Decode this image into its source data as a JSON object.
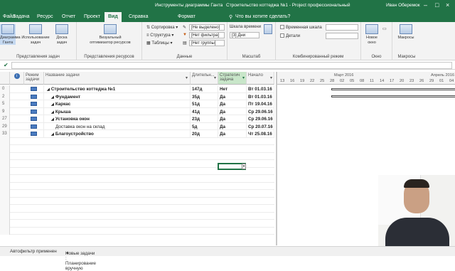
{
  "titlebar": {
    "tool": "Инструменты диаграммы Ганта",
    "document": "Строительство коттеджа №1 - Project профессиональный",
    "user": "Иван Оберемок"
  },
  "tabs": [
    "Файл",
    "Задача",
    "Ресурс",
    "Отчет",
    "Проект",
    "Вид",
    "Справка",
    "Формат",
    "Что вы хотите сделать?"
  ],
  "ribbon": {
    "groups": {
      "task_views": "Представления задач",
      "resource_views": "Представления ресурсов",
      "data": "Данные",
      "zoom": "Масштаб",
      "split": "Комбинированный режим",
      "window": "Окно",
      "macros": "Макросы"
    },
    "buttons": {
      "gantt": "Диаграмма Ганта",
      "usage": "Использование задач",
      "board": "Доска задач",
      "visual": "Визуальный оптимизатор ресурсов",
      "sort": "Сортировка",
      "outline": "Структура",
      "tables": "Таблицы",
      "highlight": "[Не выделено]",
      "filter": "[Нет фильтра]",
      "group": "[Нет группы]",
      "timescale_label": "Шкала времени",
      "timescale_value": "[3] Дни",
      "timeline": "Временная шкала",
      "details": "Детали",
      "new_window": "Новое окно",
      "macros": "Макросы"
    }
  },
  "columns": {
    "mode": "Режим задачи",
    "name": "Название задачи",
    "duration": "Длительн...",
    "strategic": "Стратегич задача",
    "start": "Начало"
  },
  "rows": [
    {
      "num": "0",
      "name": "Строительство коттеджа №1",
      "bold": true,
      "indent": 0,
      "duration": "147д",
      "strategic": "Нет",
      "start": "Вт 01.03.16"
    },
    {
      "num": "2",
      "name": "Фундамент",
      "bold": true,
      "indent": 1,
      "duration": "35д",
      "strategic": "Да",
      "start": "Вт 01.03.16"
    },
    {
      "num": "5",
      "name": "Каркас",
      "bold": true,
      "indent": 1,
      "duration": "51д",
      "strategic": "Да",
      "start": "Пт 19.04.16"
    },
    {
      "num": "9",
      "name": "Крыша",
      "bold": true,
      "indent": 1,
      "duration": "41д",
      "strategic": "Да",
      "start": "Ср 29.06.16"
    },
    {
      "num": "27",
      "name": "Установка окон",
      "bold": true,
      "indent": 1,
      "duration": "23д",
      "strategic": "Да",
      "start": "Ср 29.06.16"
    },
    {
      "num": "29",
      "name": "Доставка окон на склад",
      "bold": false,
      "indent": 2,
      "duration": "5д",
      "strategic": "Да",
      "start": "Ср 20.07.16"
    },
    {
      "num": "33",
      "name": "Благоустройство",
      "bold": true,
      "indent": 1,
      "duration": "20д",
      "strategic": "Да",
      "start": "Чт 25.08.16"
    }
  ],
  "gantt": {
    "month1": "Март 2016",
    "month2": "Апрель 2016",
    "days": [
      "13",
      "16",
      "19",
      "22",
      "25",
      "28",
      "02",
      "05",
      "08",
      "11",
      "14",
      "17",
      "20",
      "23",
      "26",
      "29",
      "01",
      "04"
    ]
  },
  "status": {
    "mode": "Автофильтр применен",
    "new_tasks": "Новые задачи : Планирование вручную"
  }
}
